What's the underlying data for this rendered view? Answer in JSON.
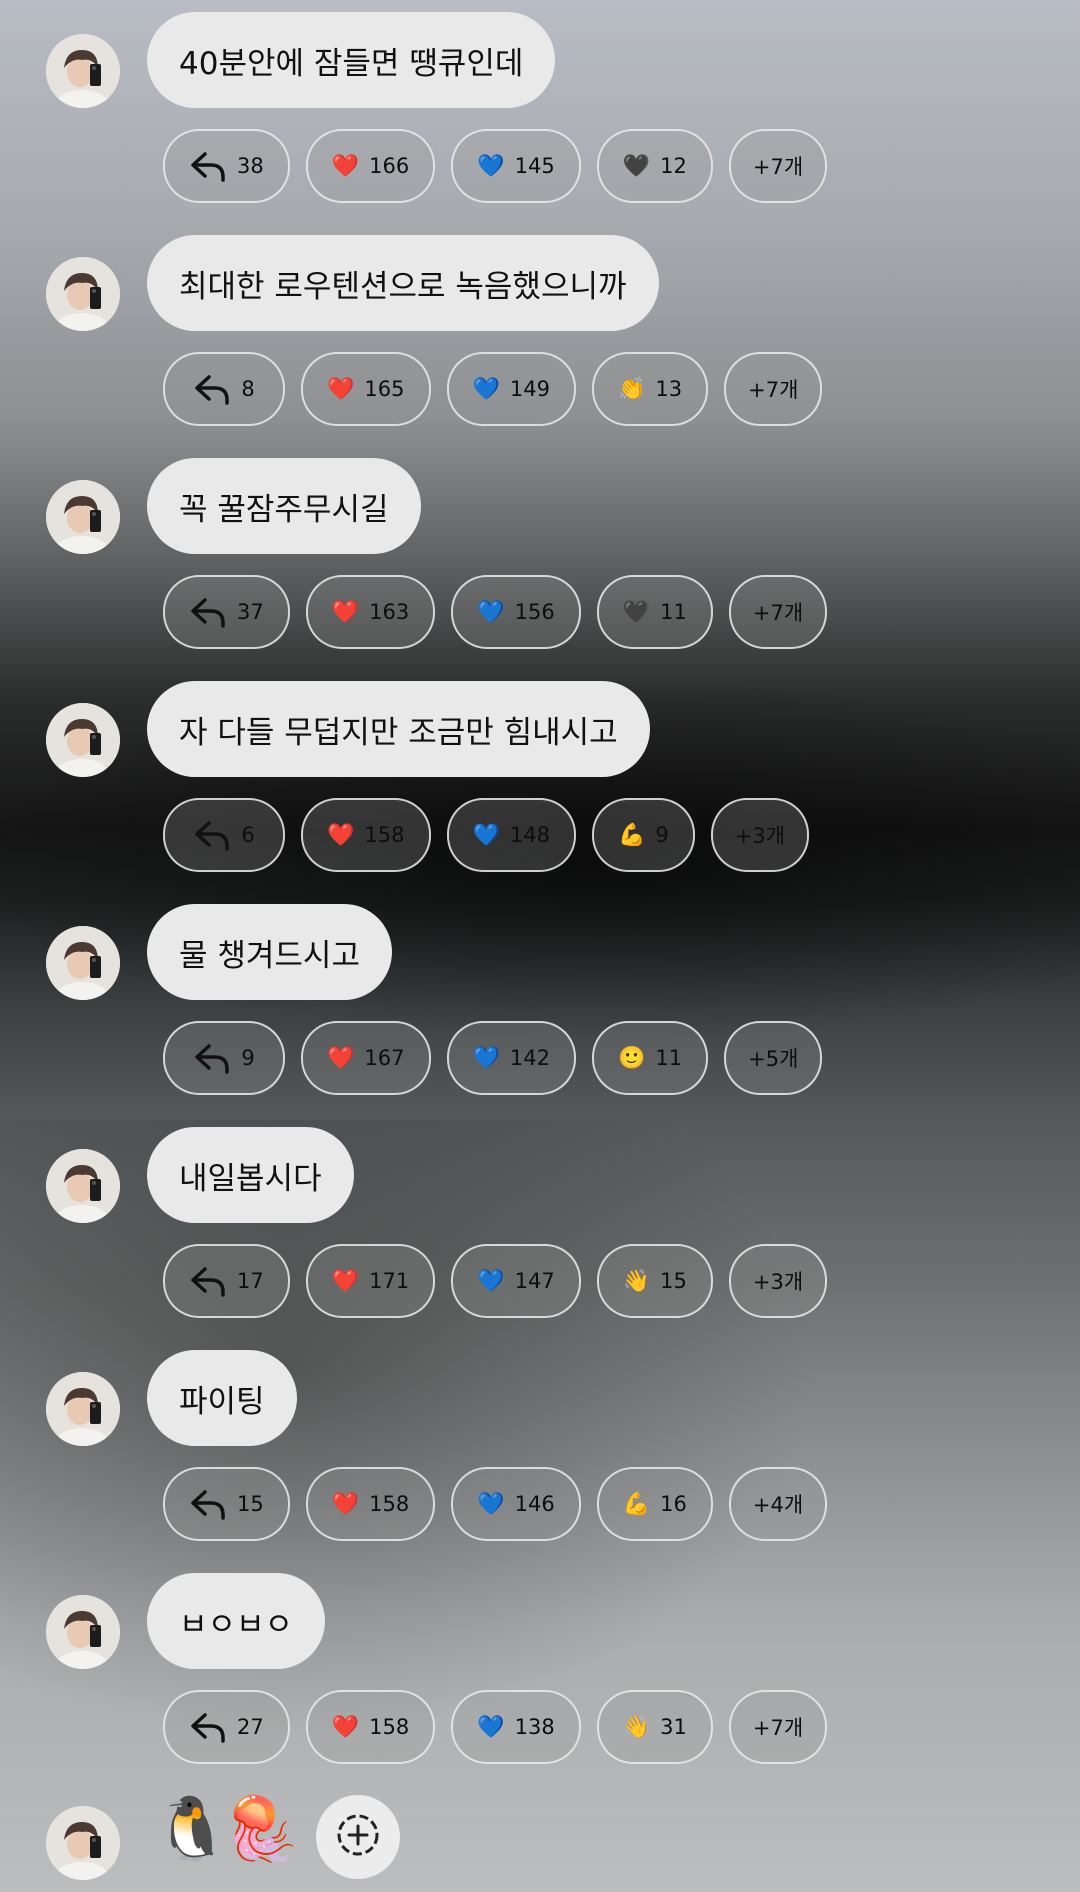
{
  "messages": [
    {
      "text": "40분안에 잠들면 땡큐인데",
      "reactions": [
        {
          "icon": "reply-arrow-icon",
          "count": "38"
        },
        {
          "icon": "red-heart-icon",
          "glyph": "❤️",
          "count": "166"
        },
        {
          "icon": "blue-heart-icon",
          "glyph": "💙",
          "count": "145"
        },
        {
          "icon": "black-heart-icon",
          "glyph": "🖤",
          "count": "12"
        },
        {
          "more": "+7개"
        }
      ]
    },
    {
      "text": "최대한 로우텐션으로 녹음했으니까",
      "reactions": [
        {
          "icon": "reply-arrow-icon",
          "count": "8"
        },
        {
          "icon": "red-heart-icon",
          "glyph": "❤️",
          "count": "165"
        },
        {
          "icon": "blue-heart-icon",
          "glyph": "💙",
          "count": "149"
        },
        {
          "icon": "clapping-hands-icon",
          "glyph": "👏",
          "count": "13"
        },
        {
          "more": "+7개"
        }
      ]
    },
    {
      "text": "꼭 꿀잠주무시길",
      "reactions": [
        {
          "icon": "reply-arrow-icon",
          "count": "37"
        },
        {
          "icon": "red-heart-icon",
          "glyph": "❤️",
          "count": "163"
        },
        {
          "icon": "blue-heart-icon",
          "glyph": "💙",
          "count": "156"
        },
        {
          "icon": "black-heart-icon",
          "glyph": "🖤",
          "count": "11"
        },
        {
          "more": "+7개"
        }
      ]
    },
    {
      "text": "자 다들 무덥지만 조금만 힘내시고",
      "reactions": [
        {
          "icon": "reply-arrow-icon",
          "count": "6"
        },
        {
          "icon": "red-heart-icon",
          "glyph": "❤️",
          "count": "158"
        },
        {
          "icon": "blue-heart-icon",
          "glyph": "💙",
          "count": "148"
        },
        {
          "icon": "flexed-biceps-icon",
          "glyph": "💪",
          "count": "9"
        },
        {
          "more": "+3개"
        }
      ]
    },
    {
      "text": "물 챙겨드시고",
      "reactions": [
        {
          "icon": "reply-arrow-icon",
          "count": "9"
        },
        {
          "icon": "red-heart-icon",
          "glyph": "❤️",
          "count": "167"
        },
        {
          "icon": "blue-heart-icon",
          "glyph": "💙",
          "count": "142"
        },
        {
          "icon": "smiling-face-icon",
          "glyph": "🙂",
          "count": "11"
        },
        {
          "more": "+5개"
        }
      ]
    },
    {
      "text": "내일봅시다",
      "reactions": [
        {
          "icon": "reply-arrow-icon",
          "count": "17"
        },
        {
          "icon": "red-heart-icon",
          "glyph": "❤️",
          "count": "171"
        },
        {
          "icon": "blue-heart-icon",
          "glyph": "💙",
          "count": "147"
        },
        {
          "icon": "waving-hand-icon",
          "glyph": "👋",
          "count": "15"
        },
        {
          "more": "+3개"
        }
      ]
    },
    {
      "text": "파이팅",
      "reactions": [
        {
          "icon": "reply-arrow-icon",
          "count": "15"
        },
        {
          "icon": "red-heart-icon",
          "glyph": "❤️",
          "count": "158"
        },
        {
          "icon": "blue-heart-icon",
          "glyph": "💙",
          "count": "146"
        },
        {
          "icon": "flexed-biceps-icon",
          "glyph": "💪",
          "count": "16"
        },
        {
          "more": "+4개"
        }
      ]
    },
    {
      "text": "ㅂㅇㅂㅇ",
      "reactions": [
        {
          "icon": "reply-arrow-icon",
          "count": "27"
        },
        {
          "icon": "red-heart-icon",
          "glyph": "❤️",
          "count": "158"
        },
        {
          "icon": "blue-heart-icon",
          "glyph": "💙",
          "count": "138"
        },
        {
          "icon": "waving-hand-icon",
          "glyph": "👋",
          "count": "31"
        },
        {
          "more": "+7개"
        }
      ]
    }
  ],
  "bottom": {
    "stickers": [
      {
        "icon": "penguin-sticker-icon",
        "glyph": "🐧"
      },
      {
        "icon": "jellyfish-sticker-icon",
        "glyph": "🪼"
      }
    ],
    "add_reaction_icon": "add-reaction-icon"
  },
  "colors": {
    "bubble": "#e9e9ea",
    "pill_border": "#ebebeb",
    "text": "#111111"
  }
}
